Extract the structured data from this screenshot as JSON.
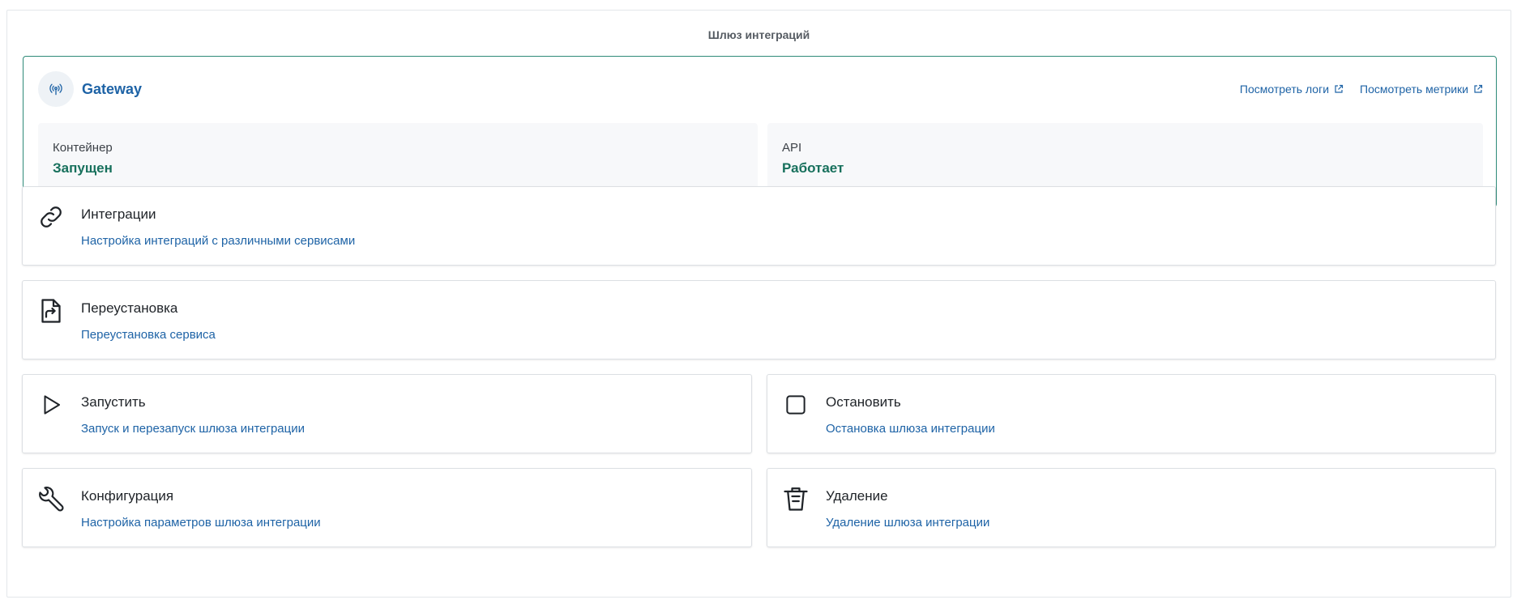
{
  "panel": {
    "title": "Шлюз интеграций"
  },
  "gateway": {
    "name": "Gateway",
    "links": {
      "logs": "Посмотреть логи",
      "metrics": "Посмотреть метрики"
    },
    "container": {
      "label": "Контейнер",
      "value": "Запущен"
    },
    "api": {
      "label": "API",
      "value": "Работает"
    }
  },
  "actions": {
    "integrations": {
      "title": "Интеграции",
      "desc": "Настройка интеграций с различными сервисами"
    },
    "reinstall": {
      "title": "Переустановка",
      "desc": "Переустановка сервиса"
    },
    "start": {
      "title": "Запустить",
      "desc": "Запуск и перезапуск шлюза интеграции"
    },
    "stop": {
      "title": "Остановить",
      "desc": "Остановка шлюза интеграции"
    },
    "config": {
      "title": "Конфигурация",
      "desc": "Настройка параметров шлюза интеграции"
    },
    "delete": {
      "title": "Удаление",
      "desc": "Удаление шлюза интеграции"
    }
  },
  "colors": {
    "accent": "#1e63a6",
    "success": "#17705c",
    "border_active": "#2e8a78"
  }
}
